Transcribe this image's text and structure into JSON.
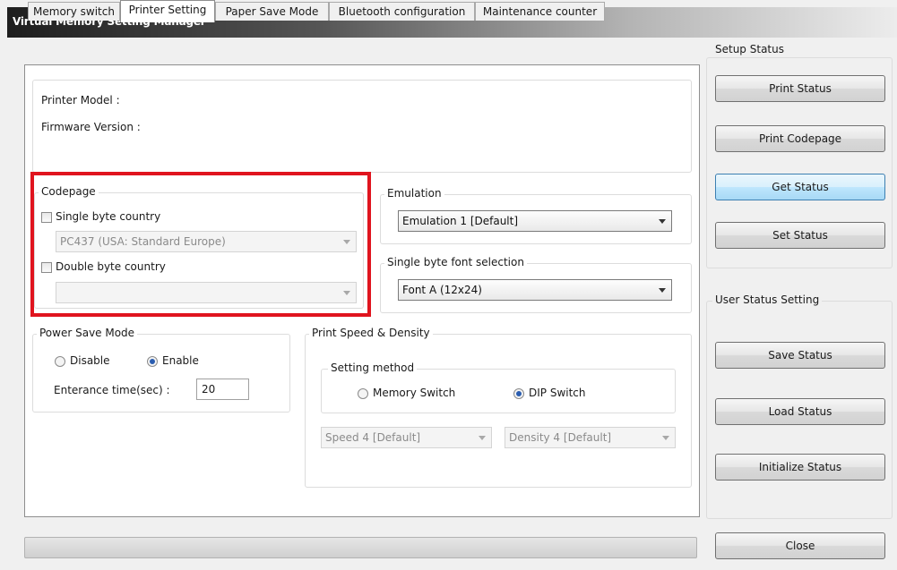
{
  "window": {
    "title": "Virtual Memory Setting Manager"
  },
  "tabs": [
    {
      "label": "Memory switch"
    },
    {
      "label": "Printer Setting"
    },
    {
      "label": "Paper Save Mode"
    },
    {
      "label": "Bluetooth configuration"
    },
    {
      "label": "Maintenance counter"
    }
  ],
  "printer_info": {
    "model_label": "Printer Model :",
    "firmware_label": "Firmware Version :"
  },
  "codepage": {
    "title": "Codepage",
    "single_byte_label": "Single byte country",
    "single_byte_checked": false,
    "single_byte_value": "PC437 (USA: Standard Europe)",
    "double_byte_label": "Double byte country",
    "double_byte_checked": false,
    "double_byte_value": ""
  },
  "emulation": {
    "title": "Emulation",
    "value": "Emulation 1 [Default]"
  },
  "font_selection": {
    "title": "Single byte font selection",
    "value": "Font A (12x24)"
  },
  "power_save": {
    "title": "Power Save Mode",
    "disable_label": "Disable",
    "enable_label": "Enable",
    "selected": "Enable",
    "entrance_label": "Enterance time(sec) :",
    "entrance_value": "20"
  },
  "print_speed": {
    "title": "Print Speed & Density",
    "setting_method_title": "Setting method",
    "memory_switch_label": "Memory Switch",
    "dip_switch_label": "DIP Switch",
    "selected": "DIP Switch",
    "speed_value": "Speed 4 [Default]",
    "density_value": "Density 4 [Default]"
  },
  "setup_status": {
    "title": "Setup Status",
    "print_status": "Print Status",
    "print_codepage": "Print Codepage",
    "get_status": "Get Status",
    "set_status": "Set Status"
  },
  "user_status": {
    "title": "User Status Setting",
    "save_status": "Save Status",
    "load_status": "Load Status",
    "initialize_status": "Initialize Status"
  },
  "footer": {
    "close": "Close"
  }
}
